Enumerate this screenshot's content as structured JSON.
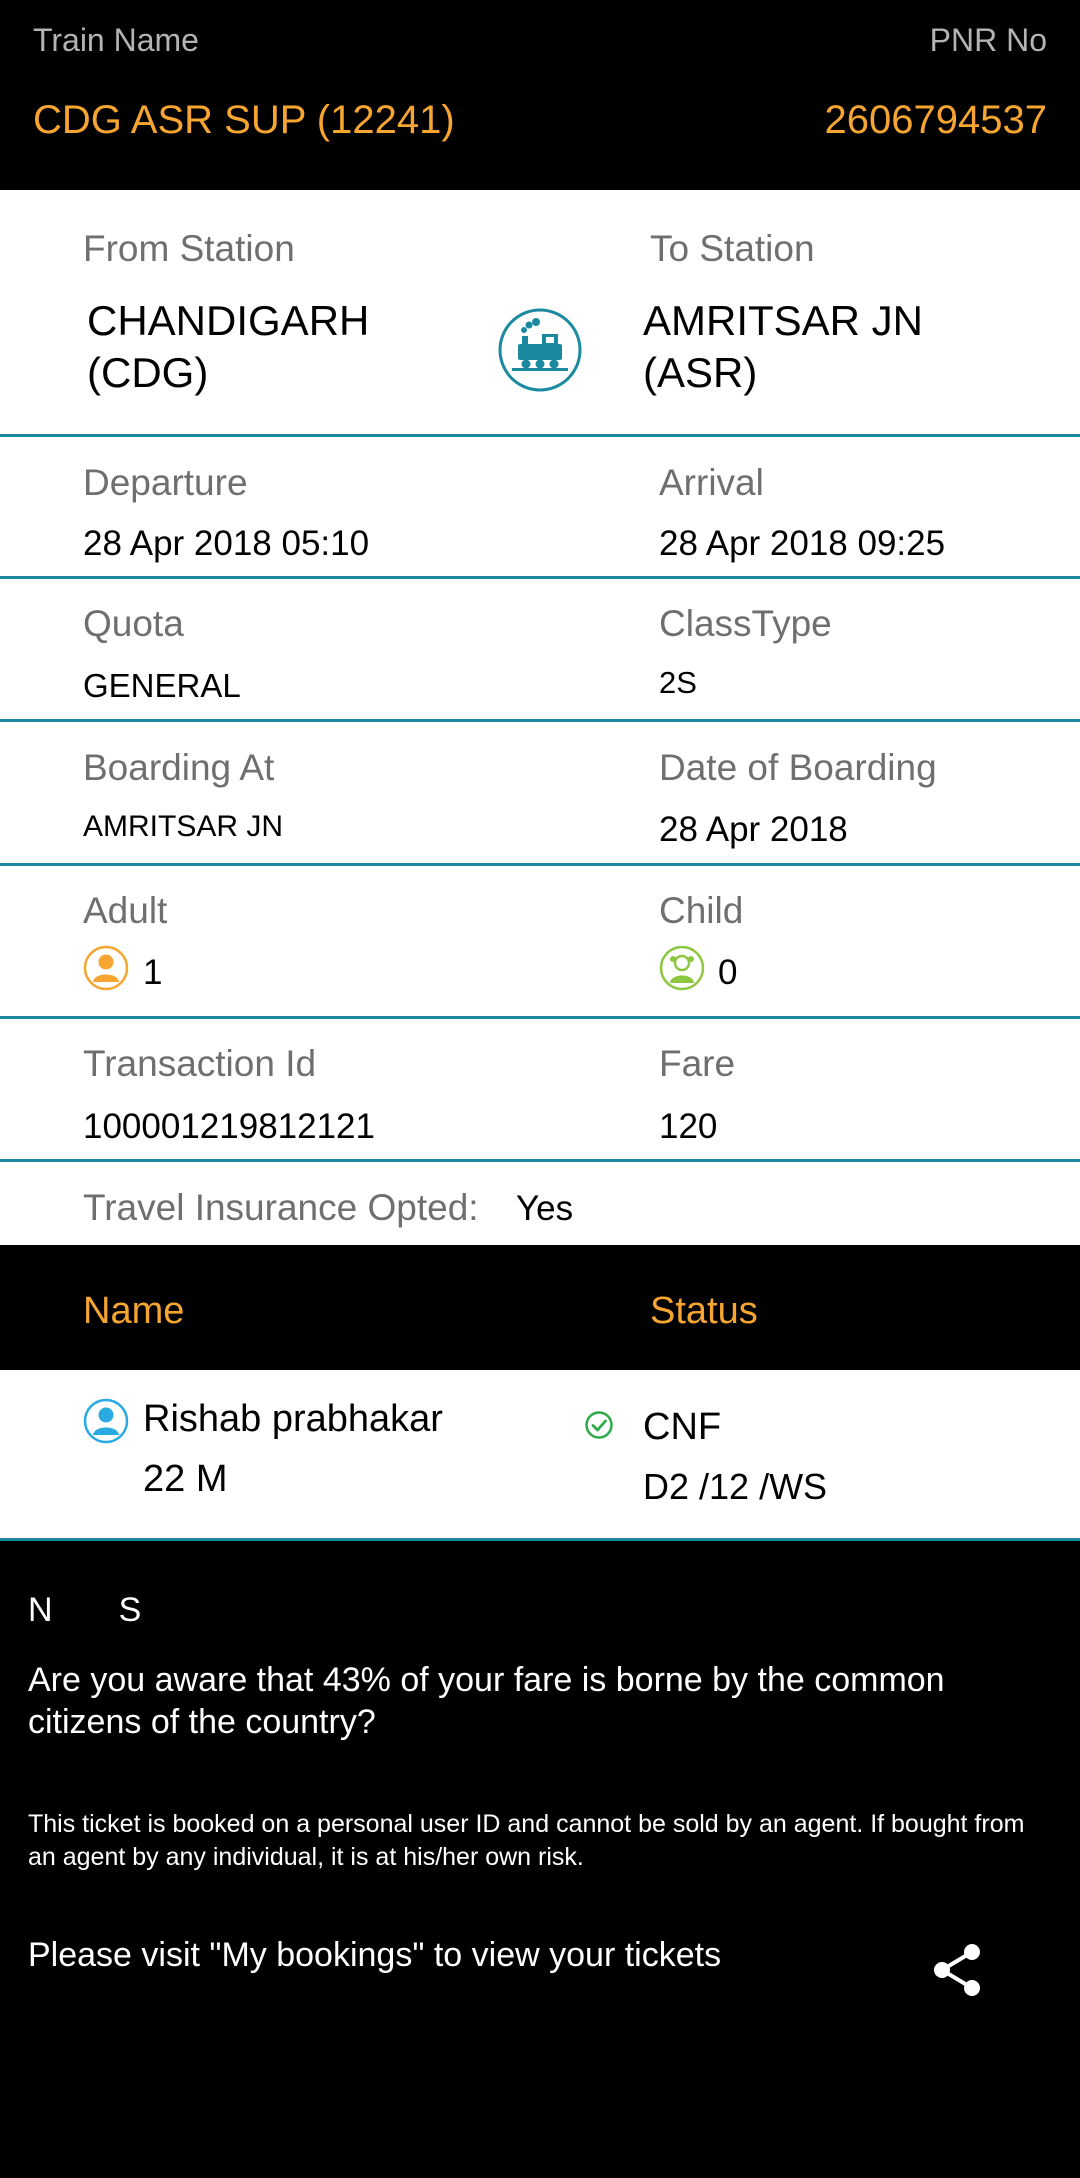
{
  "header": {
    "train_name_label": "Train Name",
    "pnr_label": "PNR No",
    "train_name": "CDG ASR SUP (12241)",
    "pnr": "2606794537"
  },
  "journey": {
    "from_label": "From Station",
    "to_label": "To Station",
    "from_line1": "CHANDIGARH",
    "from_line2": "(CDG)",
    "to_line1": "AMRITSAR JN",
    "to_line2": "(ASR)",
    "icon": "train-icon"
  },
  "details": {
    "departure_label": "Departure",
    "departure": "28 Apr 2018 05:10",
    "arrival_label": "Arrival",
    "arrival": "28 Apr 2018 09:25",
    "quota_label": "Quota",
    "quota": "GENERAL",
    "class_label": "ClassType",
    "class": "2S",
    "boarding_label": "Boarding At",
    "boarding": "AMRITSAR JN",
    "boarding_date_label": "Date of Boarding",
    "boarding_date": "28 Apr 2018",
    "adult_label": "Adult",
    "adult": "1",
    "child_label": "Child",
    "child": "0",
    "txn_label": "Transaction Id",
    "txn": "100001219812121",
    "fare_label": "Fare",
    "fare": "120",
    "insurance_label": "Travel Insurance Opted:",
    "insurance": "Yes"
  },
  "passengers": {
    "name_header": "Name",
    "status_header": "Status",
    "rows": [
      {
        "name": "Rishab prabhakar",
        "age_gender": "22 M",
        "status": "CNF",
        "berth": "D2 /12 /WS"
      }
    ]
  },
  "footer": {
    "ns": "N       S",
    "subsidy_text": "Are you aware that 43% of your fare is borne by the common citizens of the country?",
    "disclaimer": "This ticket is booked on a personal user ID and cannot be sold by an agent. If bought from an agent by any individual, it is at his/her own risk.",
    "visit_text": "Please visit \"My bookings\" to view your tickets"
  },
  "colors": {
    "accent": "#f6a531",
    "divider": "#1b8aa0",
    "adult_icon": "#f6a531",
    "child_icon": "#8dc63f",
    "passenger_icon": "#29abe2",
    "confirm_icon": "#2eaa4a"
  }
}
